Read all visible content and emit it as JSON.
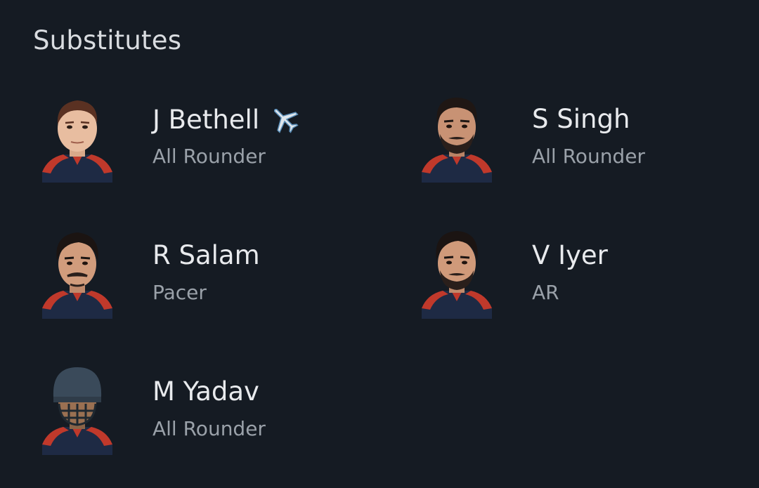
{
  "section": {
    "title": "Substitutes"
  },
  "players": [
    {
      "name": "J Bethell",
      "role": "All Rounder",
      "badge_icon": "airplane-icon",
      "avatar": "light-skin-clean-shaven"
    },
    {
      "name": "S Singh",
      "role": "All Rounder",
      "badge_icon": "",
      "avatar": "beard"
    },
    {
      "name": "R Salam",
      "role": "Pacer",
      "badge_icon": "",
      "avatar": "moustache"
    },
    {
      "name": "V Iyer",
      "role": "AR",
      "badge_icon": "",
      "avatar": "beard"
    },
    {
      "name": "M Yadav",
      "role": "All Rounder",
      "badge_icon": "",
      "avatar": "helmet"
    }
  ],
  "colors": {
    "background": "#151b23",
    "jersey_navy": "#1e2a44",
    "jersey_red": "#c0392b",
    "text_primary": "#e8eaed",
    "text_secondary": "#9aa1a9"
  }
}
